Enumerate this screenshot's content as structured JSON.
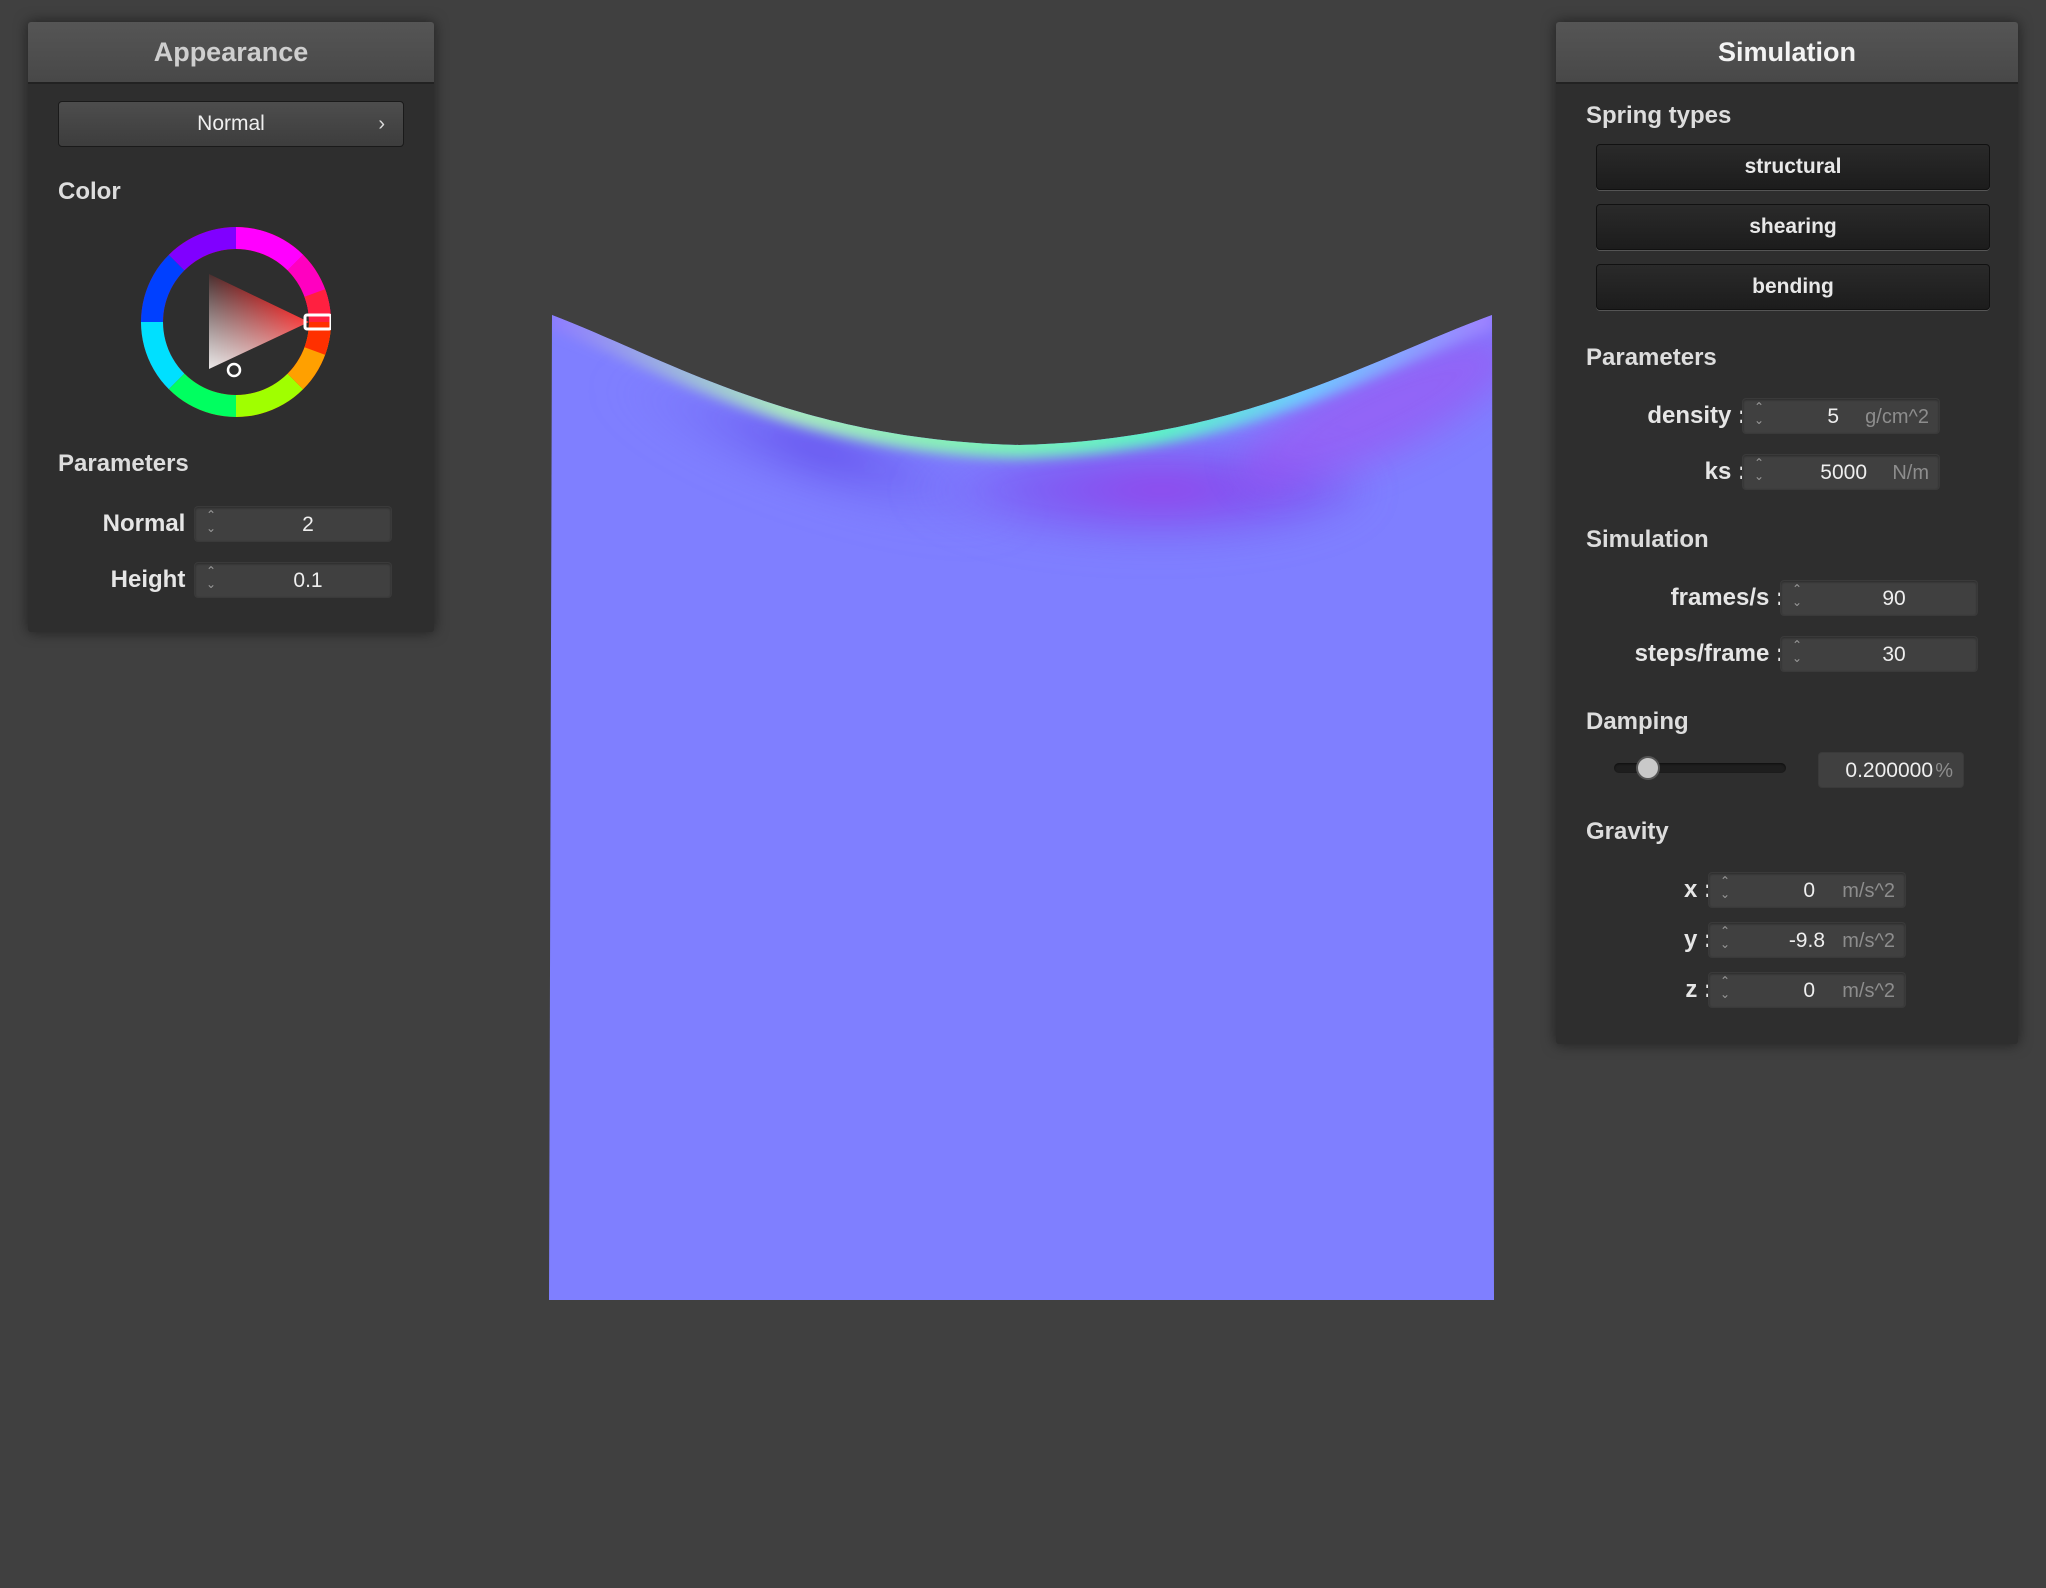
{
  "appearance": {
    "title": "Appearance",
    "shader_dropdown": {
      "value": "Normal",
      "chevron": "›"
    },
    "color_label": "Color",
    "color_picker": {
      "selected_hue": "#ff0000",
      "icon": "color-wheel-icon"
    },
    "parameters_label": "Parameters",
    "normal": {
      "label": "Normal :",
      "value": "2"
    },
    "height": {
      "label": "Height :",
      "value": "0.1"
    }
  },
  "simulation": {
    "title": "Simulation",
    "spring_types_label": "Spring types",
    "spring_buttons": [
      "structural",
      "shearing",
      "bending"
    ],
    "parameters_label": "Parameters",
    "density": {
      "label": "density :",
      "value": "5",
      "unit": "g/cm^2"
    },
    "ks": {
      "label": "ks :",
      "value": "5000",
      "unit": "N/m"
    },
    "simulation_label": "Simulation",
    "frames_per_sec": {
      "label": "frames/s :",
      "value": "90"
    },
    "steps_per_frame": {
      "label": "steps/frame :",
      "value": "30"
    },
    "damping_label": "Damping",
    "damping": {
      "value": "0.200000",
      "unit": "%",
      "slider_fraction": 0.2
    },
    "gravity_label": "Gravity",
    "gravity_x": {
      "label": "x :",
      "value": "0",
      "unit": "m/s^2"
    },
    "gravity_y": {
      "label": "y :",
      "value": "-9.8",
      "unit": "m/s^2"
    },
    "gravity_z": {
      "label": "z :",
      "value": "0",
      "unit": "m/s^2"
    }
  },
  "colors": {
    "background": "#404040",
    "panel": "#2e2e2e",
    "cloth_base": "#8080ff"
  }
}
